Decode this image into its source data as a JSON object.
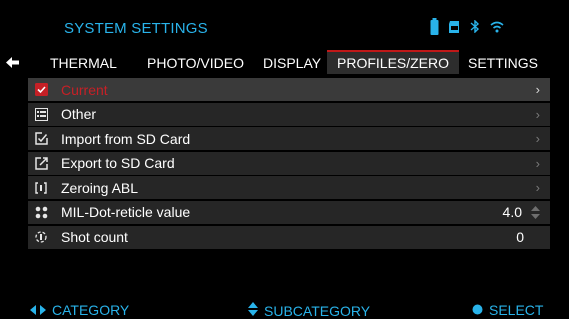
{
  "header": {
    "title": "SYSTEM SETTINGS"
  },
  "status_icons": [
    "battery-icon",
    "sd-card-icon",
    "bluetooth-icon",
    "wifi-icon"
  ],
  "tabs": [
    {
      "label": "THERMAL"
    },
    {
      "label": "PHOTO/VIDEO"
    },
    {
      "label": "DISPLAY"
    },
    {
      "label": "PROFILES/ZERO",
      "active": true
    },
    {
      "label": "SETTINGS"
    }
  ],
  "menu": {
    "items": [
      {
        "label": "Current",
        "icon": "checkbox-checked-icon",
        "selected": true
      },
      {
        "label": "Other",
        "icon": "list-icon"
      },
      {
        "label": "Import from SD Card",
        "icon": "import-icon"
      },
      {
        "label": "Export to SD Card",
        "icon": "export-icon"
      },
      {
        "label": "Zeroing ABL",
        "icon": "zeroing-icon"
      },
      {
        "label": "MIL-Dot-reticle value",
        "icon": "dots-icon",
        "value": "4.0"
      },
      {
        "label": "Shot count",
        "icon": "shot-icon",
        "value": "0"
      }
    ]
  },
  "footer": {
    "category": "CATEGORY",
    "subcategory": "SUBCATEGORY",
    "select": "SELECT"
  },
  "colors": {
    "accent": "#29b3ea",
    "selected": "#c62026",
    "battery": "#29b3ea"
  }
}
